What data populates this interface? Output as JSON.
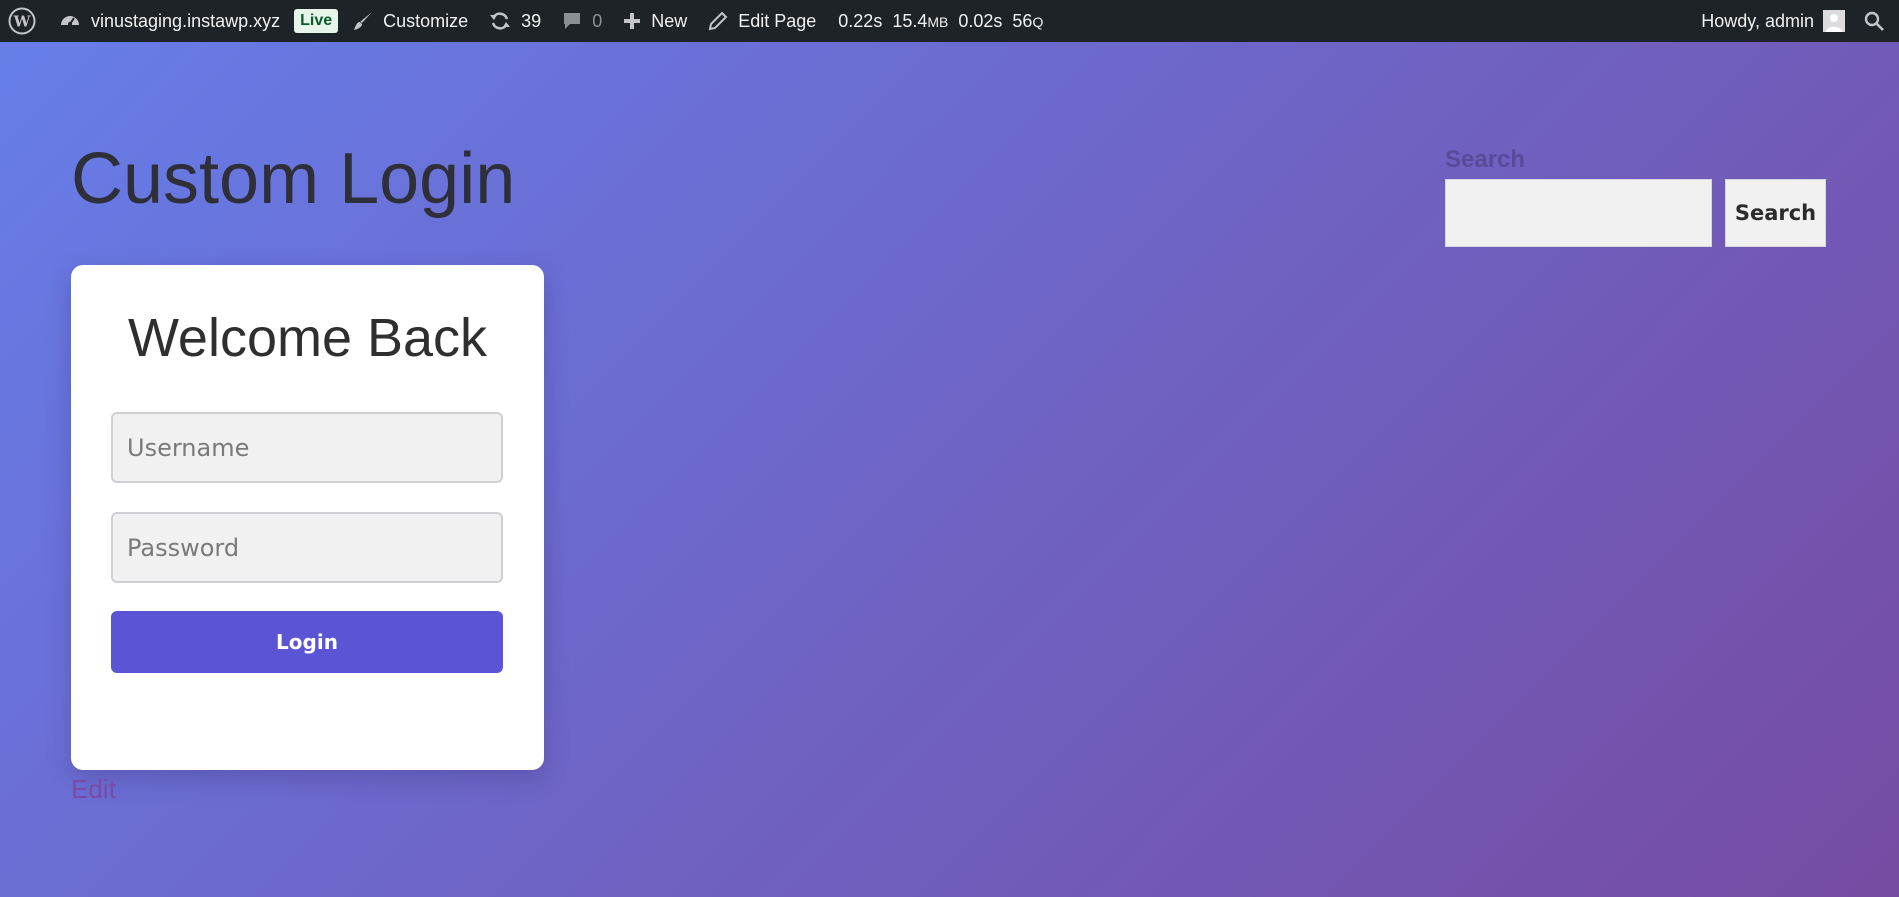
{
  "adminbar": {
    "site_name": "vinustaging.instawp.xyz",
    "live_badge": "Live",
    "customize": "Customize",
    "updates_count": "39",
    "comments_count": "0",
    "new": "New",
    "edit_page": "Edit Page",
    "qm": {
      "time": "0.22s",
      "memory_value": "15.4",
      "memory_unit": "MB",
      "db_time": "0.02s",
      "queries_value": "56",
      "queries_unit": "Q"
    },
    "greeting": "Howdy, admin",
    "icons": [
      "wordpress-logo-icon",
      "dashboard-icon",
      "brush-icon",
      "updates-icon",
      "comment-icon",
      "plus-icon",
      "pencil-icon",
      "avatar",
      "search-icon"
    ]
  },
  "main": {
    "title": "Custom Login",
    "login_form": {
      "heading": "Welcome Back",
      "username_placeholder": "Username",
      "password_placeholder": "Password",
      "button_label": "Login"
    },
    "edit_link": "Edit"
  },
  "sidebar": {
    "search": {
      "label": "Search",
      "button_label": "Search",
      "value": ""
    }
  },
  "colors": {
    "gradient_start": "#667eea",
    "gradient_end": "#764ba2",
    "login_button": "#5b55d6",
    "adminbar": "#1d2327"
  }
}
